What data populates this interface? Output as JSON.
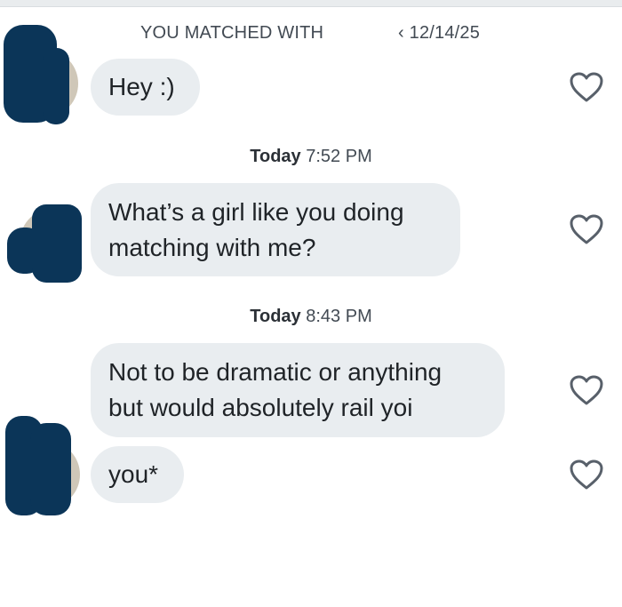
{
  "header": {
    "match_text": "YOU MATCHED WITH",
    "match_date": "‹ 12/14/25"
  },
  "messages": [
    {
      "text": "Hey :)"
    },
    {
      "timestamp_day": "Today",
      "timestamp_time": "7:52 PM",
      "line1": "What’s a girl like you doing",
      "line2": "matching with me?"
    },
    {
      "timestamp_day": "Today",
      "timestamp_time": "8:43 PM",
      "line1": "Not to be dramatic or anything",
      "line2": "but would absolutely rail yoi"
    },
    {
      "text": "you*"
    }
  ],
  "icons": {
    "like": "heart-outline-icon",
    "avatar": "redacted-avatar"
  },
  "colors": {
    "bubble": "#e9edf0",
    "redaction": "#0b3558",
    "heart": "#58606a"
  }
}
